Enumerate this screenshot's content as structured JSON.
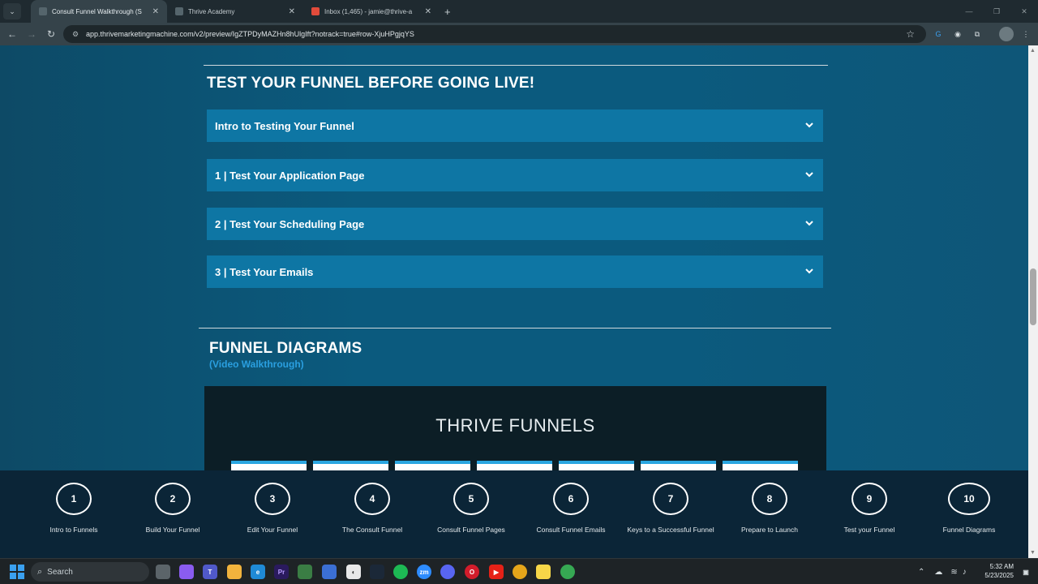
{
  "browser": {
    "tabs": [
      {
        "title": "Consult Funnel Walkthrough (S",
        "active": true
      },
      {
        "title": "Thrive Academy",
        "active": false
      },
      {
        "title": "Inbox (1,465) - jamie@thrive-a",
        "active": false
      }
    ],
    "new_tab": "+",
    "url": "app.thrivemarketingmachine.com/v2/preview/IgZTPDyMAZHn8hUlgIft?notrack=true#row-XjuHPgjqYS"
  },
  "page": {
    "testing_section": {
      "title": "TEST YOUR FUNNEL BEFORE GOING LIVE!",
      "items": [
        "Intro to Testing Your Funnel",
        "1 | Test Your Application Page",
        "2 | Test Your Scheduling Page",
        "3 | Test Your Emails"
      ]
    },
    "diagrams_section": {
      "title": "FUNNEL DIAGRAMS",
      "subtitle": "(Video Walkthrough)",
      "diagram_title": "THRIVE FUNNELS"
    }
  },
  "steps": [
    {
      "num": "1",
      "label": "Intro to Funnels"
    },
    {
      "num": "2",
      "label": "Build Your Funnel"
    },
    {
      "num": "3",
      "label": "Edit Your Funnel"
    },
    {
      "num": "4",
      "label": "The Consult Funnel"
    },
    {
      "num": "5",
      "label": "Consult Funnel Pages"
    },
    {
      "num": "6",
      "label": "Consult Funnel Emails"
    },
    {
      "num": "7",
      "label": "Keys to a Successful Funnel"
    },
    {
      "num": "8",
      "label": "Prepare to Launch"
    },
    {
      "num": "9",
      "label": "Test your Funnel"
    },
    {
      "num": "10",
      "label": "Funnel Diagrams"
    }
  ],
  "taskbar": {
    "search_label": "Search",
    "time": "5:32 AM",
    "date": "5/23/2025"
  }
}
